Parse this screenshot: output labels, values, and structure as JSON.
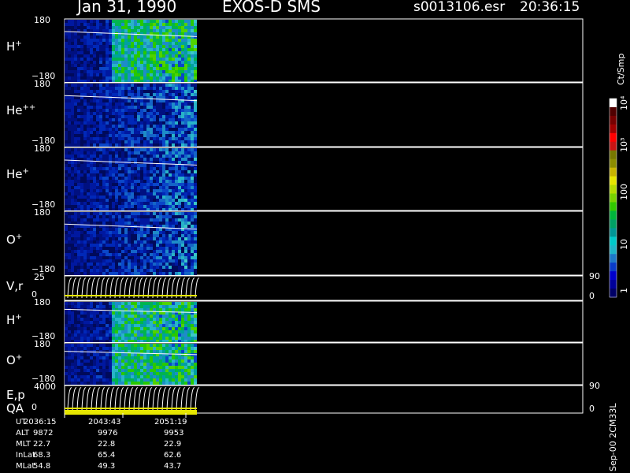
{
  "header": {
    "date": "Jan 31, 1990",
    "instrument": "EXOS-D SMS",
    "file": "s0013106.esr",
    "time": "20:36:15"
  },
  "chart_data": {
    "type": "heatmap",
    "panels": [
      {
        "label_main": "H",
        "label_sup": "+",
        "ymax": "180",
        "ymin": "−180"
      },
      {
        "label_main": "He",
        "label_sup": "++",
        "ymax": "180",
        "ymin": "−180"
      },
      {
        "label_main": "He",
        "label_sup": "+",
        "ymax": "180",
        "ymin": "−180"
      },
      {
        "label_main": "O",
        "label_sup": "+",
        "ymax": "180",
        "ymin": "−180"
      },
      {
        "label_main": "V,r",
        "label_sup": "",
        "ymax": "25",
        "ymin": "0",
        "right_max": "90",
        "right_min": "0"
      },
      {
        "label_main": "H",
        "label_sup": "+",
        "ymax": "180",
        "ymin": "−180"
      },
      {
        "label_main": "O",
        "label_sup": "+",
        "ymax": "180",
        "ymin": "−180"
      },
      {
        "label_main": "E,p",
        "label_sub": "QA",
        "ymax": "4000",
        "ymin": "0",
        "right_max": "90",
        "right_min": "0"
      }
    ],
    "colorbar": {
      "unit": "Ct/Smp",
      "ticks": [
        "1",
        "10",
        "100",
        "10³",
        "10⁴"
      ],
      "colors": [
        "#000066",
        "#00009a",
        "#0000cc",
        "#0a3cc8",
        "#1e78c8",
        "#1eb4c8",
        "#00c8c8",
        "#009696",
        "#00a064",
        "#00b43c",
        "#32c800",
        "#78d200",
        "#b4dc00",
        "#e6e600",
        "#c8b400",
        "#8c8c00",
        "#787800",
        "#c81414",
        "#ff0000",
        "#a00000",
        "#780000",
        "#500000",
        "#ffffff"
      ]
    },
    "footer": {
      "rows": [
        {
          "label": "UT",
          "values": [
            "2036:15",
            "2043:43",
            "2051:19"
          ]
        },
        {
          "label": "ALT",
          "values": [
            "9872",
            "9976",
            "9953"
          ]
        },
        {
          "label": "MLT",
          "values": [
            "22.7",
            "22.8",
            "22.9"
          ]
        },
        {
          "label": "InLat",
          "values": [
            "68.3",
            "65.4",
            "62.6"
          ]
        },
        {
          "label": "MLat",
          "values": [
            "54.8",
            "49.3",
            "43.7"
          ]
        }
      ],
      "version": "Sep-00 2CM33L"
    }
  }
}
